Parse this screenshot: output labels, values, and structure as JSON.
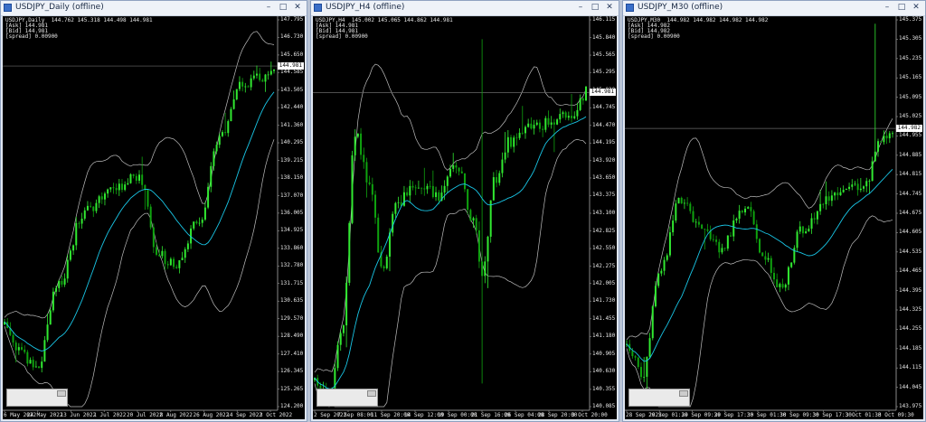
{
  "colors": {
    "candle_up": "#31e931",
    "candle_down": "#0fa30f",
    "ma": "#19c6e6",
    "band": "#bdbdbd",
    "price_line": "#6a6a6a"
  },
  "windows": [
    {
      "title": "USDJPY_Daily (offline)",
      "info": [
        "USDJPY,Daily  144.762 145.318 144.498 144.981",
        "[Ask] 144.981",
        "[Bid] 144.981",
        "[spread] 0.00900"
      ],
      "current_price": "144.981",
      "y_labels": [
        "147.795",
        "146.730",
        "145.650",
        "144.585",
        "143.505",
        "142.440",
        "141.360",
        "140.295",
        "139.215",
        "138.150",
        "137.070",
        "136.005",
        "134.925",
        "133.860",
        "132.780",
        "131.715",
        "130.635",
        "129.570",
        "128.490",
        "127.410",
        "126.345",
        "125.265",
        "124.200"
      ],
      "x_labels": [
        "6 May 2022",
        "24 May 2022",
        "13 Jun 2022",
        "1 Jul 2022",
        "20 Jul 2022",
        "8 Aug 2022",
        "26 Aug 2022",
        "14 Sep 2022",
        "3 Oct 2022"
      ],
      "chart_data": {
        "type": "candlestick",
        "price_range": [
          124.2,
          147.795
        ],
        "last": 144.981,
        "series": {
          "trend": [
            [
              0,
              129.2
            ],
            [
              0.06,
              127.6
            ],
            [
              0.12,
              126.4
            ],
            [
              0.2,
              131.8
            ],
            [
              0.3,
              136.2
            ],
            [
              0.4,
              137.4
            ],
            [
              0.5,
              138.2
            ],
            [
              0.57,
              133.5
            ],
            [
              0.63,
              132.8
            ],
            [
              0.72,
              135.5
            ],
            [
              0.8,
              140.5
            ],
            [
              0.88,
              143.8
            ],
            [
              0.95,
              144.2
            ],
            [
              1,
              145.0
            ]
          ]
        }
      }
    },
    {
      "title": "USDJPY_H4 (offline)",
      "info": [
        "USDJPY,H4  145.002 145.065 144.862 144.981",
        "[Ask] 144.981",
        "[Bid] 144.981",
        "[spread] 0.00900"
      ],
      "current_price": "144.981",
      "y_labels": [
        "146.115",
        "145.840",
        "145.565",
        "145.295",
        "145.020",
        "144.745",
        "144.470",
        "144.195",
        "143.920",
        "143.650",
        "143.375",
        "143.100",
        "142.825",
        "142.550",
        "142.275",
        "142.005",
        "141.730",
        "141.455",
        "141.180",
        "140.905",
        "140.630",
        "140.355",
        "140.085"
      ],
      "x_labels": [
        "2 Sep 2022",
        "7 Sep 08:00",
        "11 Sep 20:00",
        "14 Sep 12:00",
        "19 Sep 00:00",
        "21 Sep 16:00",
        "26 Sep 04:00",
        "28 Sep 20:00",
        "3 Oct 20:00"
      ],
      "chart_data": {
        "type": "candlestick",
        "price_range": [
          140.085,
          146.115
        ],
        "last": 144.981,
        "series": {
          "trend": [
            [
              0,
              140.5
            ],
            [
              0.05,
              140.2
            ],
            [
              0.1,
              141.3
            ],
            [
              0.15,
              144.3
            ],
            [
              0.2,
              143.6
            ],
            [
              0.25,
              142.3
            ],
            [
              0.3,
              143.2
            ],
            [
              0.38,
              143.6
            ],
            [
              0.45,
              143.4
            ],
            [
              0.52,
              143.9
            ],
            [
              0.58,
              143.0
            ],
            [
              0.62,
              142.2
            ],
            [
              0.66,
              143.6
            ],
            [
              0.72,
              144.2
            ],
            [
              0.8,
              144.5
            ],
            [
              0.88,
              144.5
            ],
            [
              0.94,
              144.6
            ],
            [
              1,
              145.0
            ]
          ]
        }
      }
    },
    {
      "title": "USDJPY_M30 (offline)",
      "info": [
        "USDJPY,M30  144.982 144.982 144.982 144.982",
        "[Ask] 144.982",
        "[Bid] 144.982",
        "[spread] 0.00900"
      ],
      "current_price": "144.982",
      "y_labels": [
        "145.375",
        "145.305",
        "145.235",
        "145.165",
        "145.095",
        "145.025",
        "144.955",
        "144.885",
        "144.815",
        "144.745",
        "144.675",
        "144.605",
        "144.535",
        "144.465",
        "144.395",
        "144.325",
        "144.255",
        "144.185",
        "144.115",
        "144.045",
        "143.975"
      ],
      "x_labels": [
        "28 Sep 2022",
        "29 Sep 01:30",
        "29 Sep 09:30",
        "29 Sep 17:30",
        "30 Sep 01:30",
        "30 Sep 09:30",
        "30 Sep 17:30",
        "3 Oct 01:30",
        "3 Oct 09:30"
      ],
      "chart_data": {
        "type": "candlestick",
        "price_range": [
          143.975,
          145.375
        ],
        "last": 144.982,
        "series": {
          "trend": [
            [
              0,
              144.2
            ],
            [
              0.06,
              144.08
            ],
            [
              0.12,
              144.45
            ],
            [
              0.2,
              144.72
            ],
            [
              0.28,
              144.62
            ],
            [
              0.35,
              144.55
            ],
            [
              0.45,
              144.7
            ],
            [
              0.52,
              144.52
            ],
            [
              0.58,
              144.4
            ],
            [
              0.66,
              144.62
            ],
            [
              0.75,
              144.72
            ],
            [
              0.83,
              144.76
            ],
            [
              0.9,
              144.78
            ],
            [
              0.95,
              144.92
            ],
            [
              1,
              144.98
            ]
          ]
        }
      }
    }
  ]
}
